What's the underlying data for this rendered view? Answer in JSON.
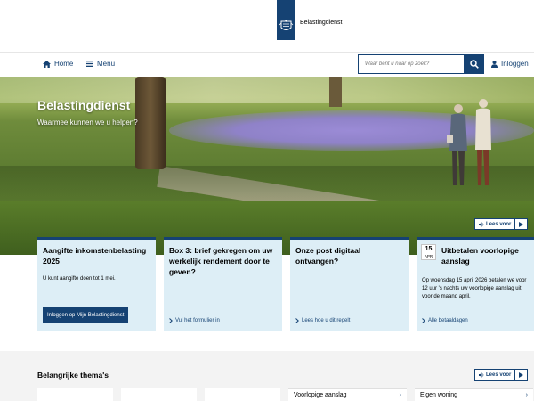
{
  "header": {
    "logo_text": "Belastingdienst"
  },
  "nav": {
    "home_label": "Home",
    "menu_label": "Menu",
    "search_placeholder": "Waar bent u naar op zoek?",
    "login_label": "Inloggen"
  },
  "hero": {
    "title": "Belastingdienst",
    "subtitle": "Waarmee kunnen we u helpen?",
    "read_aloud_label": "Lees voor"
  },
  "cards": [
    {
      "title": "Aangifte inkomstenbelasting 2025",
      "text": "U kunt aangifte doen tot 1 mei.",
      "button_label": "Inloggen op Mijn Belastingdienst"
    },
    {
      "title": "Box 3: brief gekregen om uw werkelijk rendement door te geven?",
      "link_label": "Vul het formulier in"
    },
    {
      "title": "Onze post digitaal ontvangen?",
      "link_label": "Lees hoe u dit regelt"
    },
    {
      "date_day": "15",
      "date_month": "APR",
      "title": "Uitbetalen voorlopige aanslag",
      "text": "Op woensdag 15 april 2026 betalen we voor 12 uur 's nachts uw voorlopige aanslag uit voor de maand april.",
      "link_label": "Alle betaaldagen"
    }
  ],
  "themes": {
    "title": "Belangrijke thema's",
    "read_aloud_label": "Lees voor",
    "links": [
      "Voorlopige aanslag",
      "Eigen woning"
    ]
  },
  "colors": {
    "brand_blue": "#154273",
    "card_background": "#ddeef6"
  }
}
